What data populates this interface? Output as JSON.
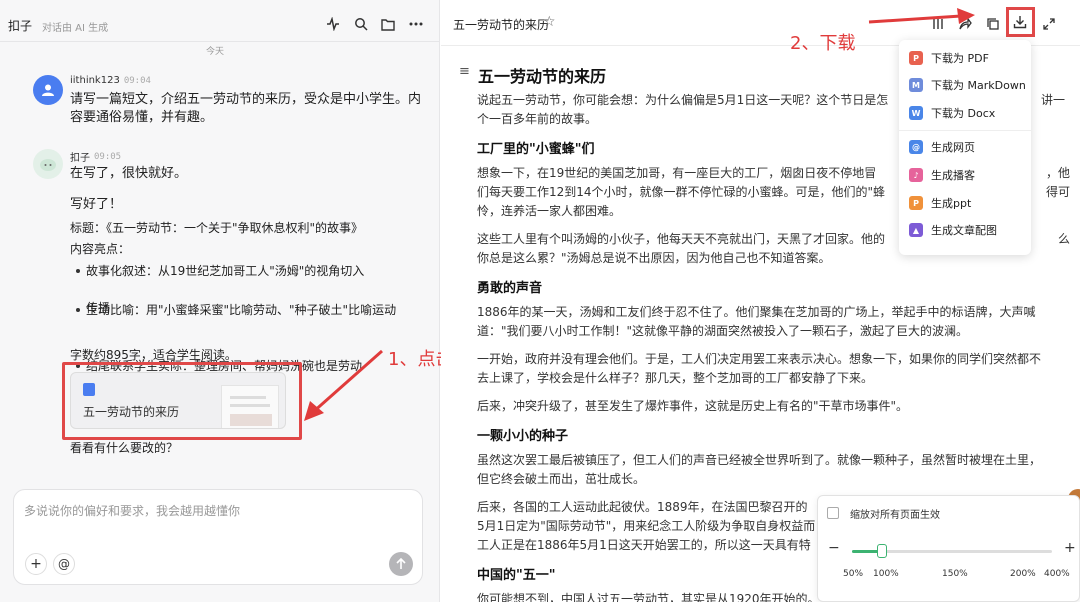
{
  "left_header": {
    "title": "扣子",
    "subtitle": "对话由 AI 生成",
    "day_label": "今天"
  },
  "icons": {
    "activity": "activity-icon",
    "search": "search-icon",
    "folder": "folder-icon",
    "more": "more-icon"
  },
  "user_message": {
    "name": "iithink123",
    "time": "09:04",
    "text_line1": "请写一篇短文，介绍五一劳动节的来历，受众是中小学生。内",
    "text_line2": "容要通俗易懂，并有趣。"
  },
  "bot_message": {
    "name": "扣子",
    "time": "09:05",
    "status": "在写了，很快就好。",
    "done": "写好了！",
    "title_line": "标题：《五一劳动节：一个关于\"争取休息权利\"的故事》",
    "highlights_label": "内容亮点：",
    "bullets": [
      "故事化叙述：从19世纪芝加哥工人\"汤姆\"的视角切入",
      "生动比喻：用\"小蜜蜂采蜜\"比喻劳动、\"种子破土\"比喻运动",
      "传播",
      "结尾联系学生实际：整理房间、帮妈妈洗碗也是劳动"
    ],
    "word_count": "字数约895字，适合学生阅读。",
    "doc_card_title": "五一劳动节的来历",
    "followup": "看看有什么要改的？"
  },
  "input": {
    "placeholder": "多说说你的偏好和要求，我会越用越懂你",
    "plus": "+",
    "at": "@"
  },
  "annotations": {
    "step1": "1、点击",
    "step2": "2、下载"
  },
  "right_header": {
    "title": "五一劳动节的来历"
  },
  "download_menu": {
    "items": [
      {
        "label": "下载为 PDF",
        "icon": "pdf-icon",
        "color": "#e8614f"
      },
      {
        "label": "下载为 MarkDown",
        "icon": "markdown-icon",
        "color": "#6f8cdb"
      },
      {
        "label": "下载为 Docx",
        "icon": "docx-icon",
        "color": "#4a86e8"
      },
      {
        "label": "生成网页",
        "icon": "web-icon",
        "color": "#4a86e8"
      },
      {
        "label": "生成播客",
        "icon": "podcast-icon",
        "color": "#e6639b"
      },
      {
        "label": "生成ppt",
        "icon": "ppt-icon",
        "color": "#f0913a"
      },
      {
        "label": "生成文章配图",
        "icon": "image-icon",
        "color": "#7d5bd6"
      }
    ]
  },
  "document": {
    "title": "五一劳动节的来历",
    "p1a": "说起五一劳动节，你可能会想：为什么偏偏是5月1日这一天呢？这个节日是怎",
    "p1b": "讲一",
    "p1c": "个一百多年前的故事。",
    "h_factory": "工厂里的\"小蜜蜂\"们",
    "p2a": "想象一下，在19世纪的美国芝加哥，有一座巨大的工厂，烟囱日夜不停地冒",
    "p2a_end": "，他",
    "p2b": "们每天要工作12到14个小时，就像一群不停忙碌的小蜜蜂。可是，他们的\"蜂",
    "p2b_end": "得可",
    "p2c": "怜，连养活一家人都困难。",
    "p3a": "这些工人里有个叫汤姆的小伙子，他每天天不亮就出门，天黑了才回家。他的",
    "p3a_end": "么",
    "p3b": "你总是这么累？\"汤姆总是说不出原因，因为他自己也不知道答案。",
    "h_brave": "勇敢的声音",
    "p4a": "1886年的某一天，汤姆和工友们终于忍不住了。他们聚集在芝加哥的广场上，举起手中的标语牌，大声喊",
    "p4b": "道：\"我们要八小时工作制！\"这就像平静的湖面突然被投入了一颗石子，激起了巨大的波澜。",
    "p5a": "一开始，政府并没有理会他们。于是，工人们决定用罢工来表示决心。想象一下，如果你的同学们突然都不",
    "p5b": "去上课了，学校会是什么样子？那几天，整个芝加哥的工厂都安静了下来。",
    "p6": "后来，冲突升级了，甚至发生了爆炸事件，这就是历史上有名的\"干草市场事件\"。",
    "h_seed": "一颗小小的种子",
    "p7a": "虽然这次罢工最后被镇压了，但工人们的声音已经被全世界听到了。就像一颗种子，虽然暂时被埋在土里，",
    "p7b": "但它终会破土而出，茁壮成长。",
    "p8a": "后来，各国的工人运动此起彼伏。1889年，在法国巴黎召开的",
    "p8b": "5月1日定为\"国际劳动节\"，用来纪念工人阶级为争取自身权益而",
    "p8c": "工人正是在1886年5月1日这天开始罢工的，所以这一天具有特",
    "h_china": "中国的\"五一\"",
    "p9": "你可能想不到，中国人过五一劳动节，其实是从1920年开始的。"
  },
  "zoom_panel": {
    "checkbox_label": "缩放对所有页面生效",
    "minus": "−",
    "plus": "+",
    "ticks": [
      "50%",
      "100%",
      "150%",
      "200%",
      "400%"
    ],
    "value_percent": 100
  }
}
